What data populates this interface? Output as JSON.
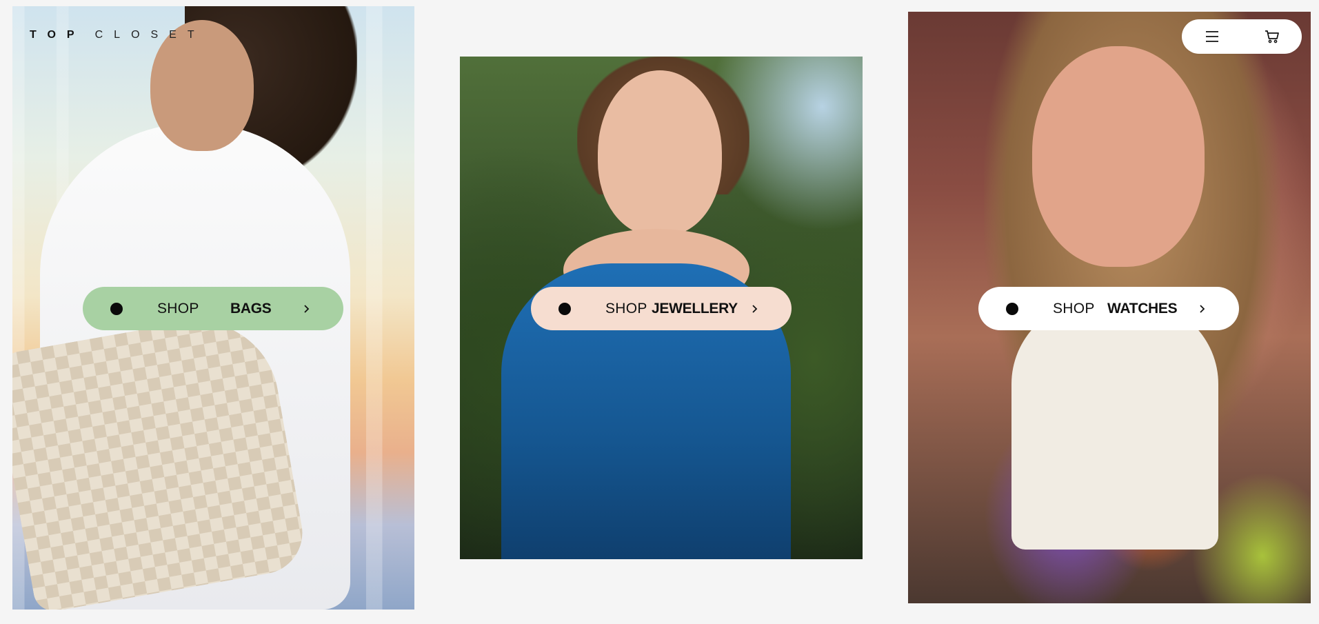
{
  "brand": {
    "logo_top": "TOP",
    "logo_closet": "CLOSET"
  },
  "nav": {
    "menu_icon": "menu-icon",
    "cart_icon": "cart-icon"
  },
  "panels": [
    {
      "shop_label": "SHOP",
      "category": "BAGS",
      "pill_color": "#a8d1a3"
    },
    {
      "shop_label": "SHOP",
      "category": "JEWELLERY",
      "pill_color": "#f6ddd0"
    },
    {
      "shop_label": "SHOP",
      "category": "WATCHES",
      "pill_color": "#ffffff"
    }
  ],
  "colors": {
    "background": "#f5f5f5",
    "text": "#111111"
  }
}
